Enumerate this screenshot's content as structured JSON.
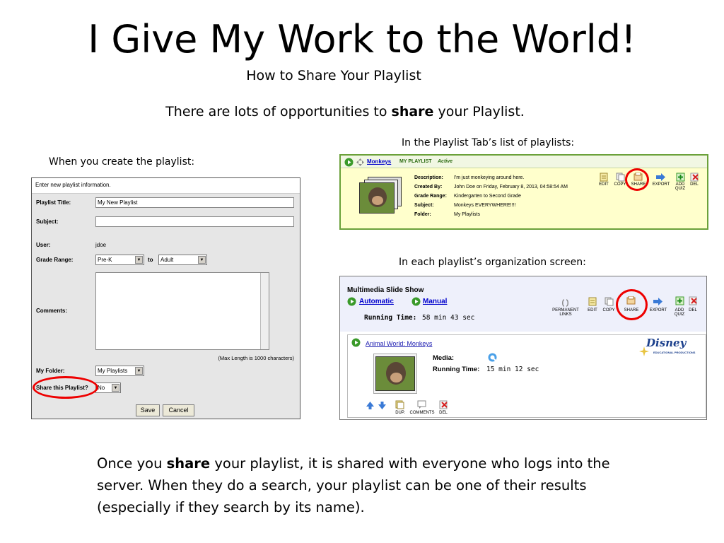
{
  "slide": {
    "title": "I Give My Work to the World!",
    "subtitle": "How to Share Your Playlist",
    "lead_pre": "There are lots of opportunities to ",
    "lead_bold": "share",
    "lead_post": " your Playlist.",
    "caption_create": "When you create the playlist:",
    "caption_tab": "In the Playlist Tab’s list of playlists:",
    "caption_org": "In each playlist’s organization screen:",
    "body_pre": "Once you ",
    "body_bold": "share",
    "body_post": " your playlist, it is shared with everyone who logs into the server.  When they do a search, your playlist can be one of their results (especially if they search by its name)."
  },
  "create_form": {
    "header": "Enter new playlist information.",
    "playlist_title_label": "Playlist Title:",
    "playlist_title_value": "My New Playlist",
    "subject_label": "Subject:",
    "subject_value": "",
    "user_label": "User:",
    "user_value": "jdoe",
    "grade_label": "Grade Range:",
    "grade_from": "Pre-K",
    "grade_to_word": "to",
    "grade_to": "Adult",
    "comments_label": "Comments:",
    "max_length_note": "(Max Length is 1000 characters)",
    "folder_label": "My Folder:",
    "folder_value": "My Playlists",
    "share_label": "Share this Playlist?",
    "share_value": "No",
    "save_label": "Save",
    "cancel_label": "Cancel",
    "highlight_color": "#e00000"
  },
  "playlist_tab": {
    "name": "Monkeys",
    "tag": "MY PLAYLIST",
    "status": "Active",
    "description_label": "Description:",
    "description": "I'm just monkeying around here.",
    "created_label": "Created By:",
    "created": "John Doe on Friday, February 8, 2013, 04:58:54 AM",
    "grade_label": "Grade Range:",
    "grade": "Kindergarten to Second Grade",
    "subject_label": "Subject:",
    "subject": "Monkeys EVERYWHERE!!!!",
    "folder_label": "Folder:",
    "folder": "My Playlists",
    "actions": [
      "EDIT",
      "COPY",
      "SHARE",
      "EXPORT",
      "ADD QUIZ",
      "DEL"
    ]
  },
  "org_screen": {
    "title": "Multimedia Slide Show",
    "mode_auto": "Automatic",
    "mode_manual": "Manual",
    "running_label": "Running Time:",
    "running_value": "58 min 43 sec",
    "actions": [
      "PERMANENT LINKS",
      "EDIT",
      "COPY",
      "SHARE",
      "EXPORT",
      "ADD QUIZ",
      "DEL"
    ],
    "item_title": "Animal World: Monkeys",
    "media_label": "Media:",
    "item_running_label": "Running Time:",
    "item_running_value": "15 min 12 sec",
    "logo_text": "Disney",
    "logo_sub": "EDUCATIONAL PRODUCTIONS",
    "item_actions": [
      "DUP.",
      "COMMENTS",
      "DEL"
    ]
  }
}
